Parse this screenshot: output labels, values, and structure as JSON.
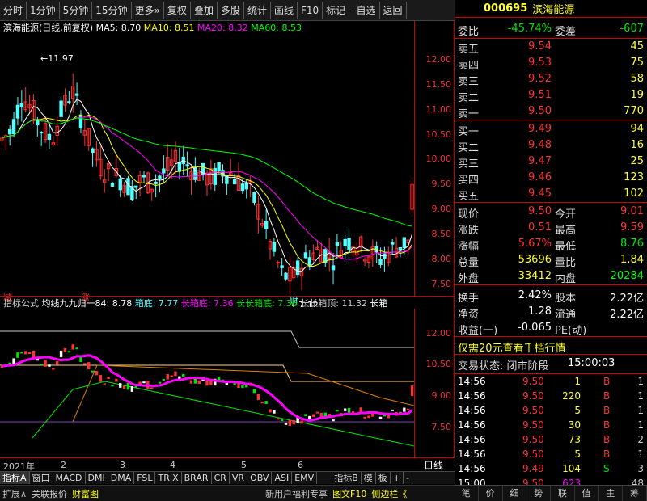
{
  "toolbar": {
    "items": [
      "分时",
      "1分钟",
      "5分钟",
      "15分钟",
      "更多»",
      "复权",
      "叠加",
      "多股",
      "统计",
      "画线",
      "F10",
      "标记",
      "-自选",
      "返回"
    ]
  },
  "stock": {
    "code": "000695",
    "name": "滨海能源",
    "chart_title": "滨海能源(日线,前复权)"
  },
  "ma_legend": [
    {
      "label": "MA5: 8.70",
      "color": "#ffffff"
    },
    {
      "label": "MA10: 8.51",
      "color": "#ffff00"
    },
    {
      "label": "MA20: 8.32",
      "color": "#ff00ff"
    },
    {
      "label": "MA60: 8.53",
      "color": "#00ff00"
    }
  ],
  "price_axis": [
    "12.00",
    "11.50",
    "11.00",
    "10.50",
    "10.00",
    "9.50",
    "9.00",
    "8.50",
    "8.00",
    "7.50"
  ],
  "annotations": {
    "high": "11.97",
    "low": "7.12",
    "jian": "减",
    "zhang": "涨",
    "cai": "财"
  },
  "indicator": {
    "name": "指标公式",
    "title": "均线九九归一84: 8.78",
    "xiangdi": "箱底: 7.77",
    "changxiangdi": "长箱底: 7.36",
    "cc_xiangdi": "长长箱底: 7.36",
    "cc_xiangding": "长长箱顶: 11.32",
    "tail": "长箱"
  },
  "indicator_axis": [
    "12.00",
    "10.50",
    "9.00",
    "7.50"
  ],
  "x_labels": [
    "2021年",
    "2",
    "3",
    "4",
    "5",
    "6"
  ],
  "day_label": "日线",
  "bottom_tabs": [
    "指标A",
    "窗口",
    "MACD",
    "DMI",
    "DMA",
    "FSL",
    "TRIX",
    "BRAR",
    "CR",
    "VR",
    "OBV",
    "ASI",
    "EMV",
    "指标B",
    "模",
    "板",
    "+",
    "-"
  ],
  "status": {
    "expand": "扩展∧",
    "report": "关联报价",
    "portfolio": "财富图",
    "promo": "新用户福利专享",
    "f10": "图文F10",
    "sidebar": "侧边栏《"
  },
  "quote": {
    "weibi_label": "委比",
    "weibi": "-45.74%",
    "weicha_label": "委差",
    "weicha": "-607",
    "asks": [
      {
        "l": "卖五",
        "p": "9.54",
        "v": "45"
      },
      {
        "l": "卖四",
        "p": "9.53",
        "v": "75"
      },
      {
        "l": "卖三",
        "p": "9.52",
        "v": "58"
      },
      {
        "l": "卖二",
        "p": "9.51",
        "v": "19"
      },
      {
        "l": "卖一",
        "p": "9.50",
        "v": "770"
      }
    ],
    "bids": [
      {
        "l": "买一",
        "p": "9.49",
        "v": "94"
      },
      {
        "l": "买二",
        "p": "9.48",
        "v": "16"
      },
      {
        "l": "买三",
        "p": "9.47",
        "v": "25"
      },
      {
        "l": "买四",
        "p": "9.46",
        "v": "123"
      },
      {
        "l": "买五",
        "p": "9.45",
        "v": "102"
      }
    ],
    "stats": [
      {
        "a": "现价",
        "av": "9.50",
        "b": "今开",
        "bv": "9.01"
      },
      {
        "a": "涨跌",
        "av": "0.51",
        "b": "最高",
        "bv": "9.59"
      },
      {
        "a": "涨幅",
        "av": "5.67%",
        "b": "最低",
        "bv": "8.76"
      },
      {
        "a": "总量",
        "av": "53696",
        "b": "量比",
        "bv": "1.84"
      },
      {
        "a": "外盘",
        "av": "33412",
        "b": "内盘",
        "bv": "20284"
      }
    ],
    "stats2": [
      {
        "a": "换手",
        "av": "2.42%",
        "b": "股本",
        "bv": "2.22亿"
      },
      {
        "a": "净资",
        "av": "1.28",
        "b": "流通",
        "bv": "2.22亿"
      },
      {
        "a": "收益(一)",
        "av": "-0.065",
        "b": "PE(动)",
        "bv": ""
      }
    ],
    "promo": "仅需20元查看千档行情",
    "trade_state": "交易状态: 闭市阶段",
    "trade_time": "15:00:03",
    "ticks": [
      {
        "t": "14:56",
        "p": "9.50",
        "v": "1",
        "d": "B",
        "n": "1"
      },
      {
        "t": "14:56",
        "p": "9.50",
        "v": "220",
        "d": "B",
        "n": "1"
      },
      {
        "t": "14:56",
        "p": "9.50",
        "v": "5",
        "d": "B",
        "n": "1"
      },
      {
        "t": "14:56",
        "p": "9.50",
        "v": "30",
        "d": "B",
        "n": "1"
      },
      {
        "t": "14:56",
        "p": "9.50",
        "v": "73",
        "d": "B",
        "n": "2"
      },
      {
        "t": "14:56",
        "p": "9.50",
        "v": "5",
        "d": "B",
        "n": "1"
      },
      {
        "t": "14:56",
        "p": "9.49",
        "v": "104",
        "d": "S",
        "n": "3"
      },
      {
        "t": "15:00",
        "p": "9.50",
        "v": "623",
        "d": "",
        "n": "48"
      }
    ],
    "tabs": [
      "笔",
      "价",
      "细",
      "势",
      "联",
      "值",
      "主",
      "筹"
    ]
  },
  "colors": {
    "up": "#ff3232",
    "down": "#54ffff",
    "green": "#00e600",
    "yellow": "#ffff00",
    "magenta": "#ff00ff",
    "axis": "#c00000"
  }
}
